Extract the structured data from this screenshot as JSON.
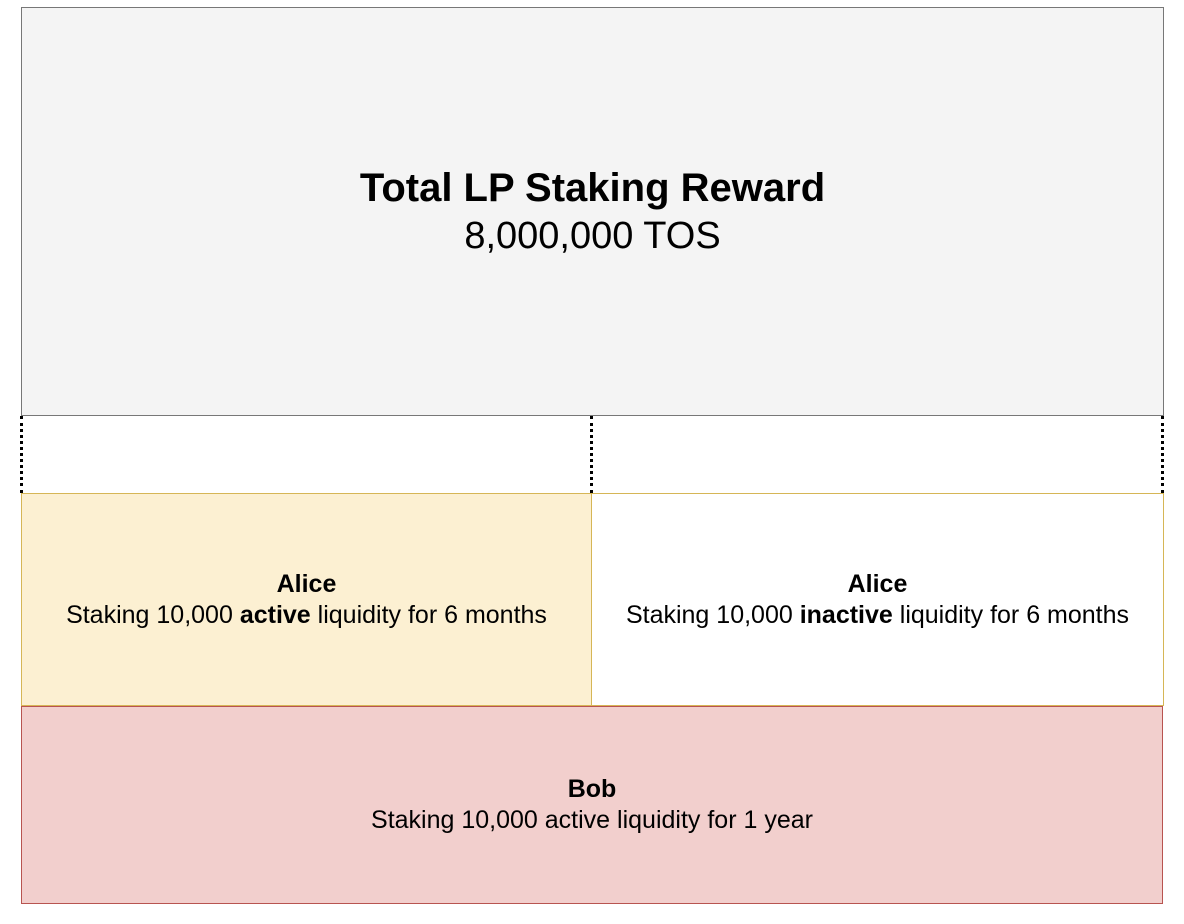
{
  "total": {
    "title": "Total LP Staking Reward",
    "amount": "8,000,000 TOS"
  },
  "alice_active": {
    "name": "Alice",
    "desc_prefix": "Staking 10,000 ",
    "desc_emphasis": "active",
    "desc_suffix": " liquidity for 6 months"
  },
  "alice_inactive": {
    "name": "Alice",
    "desc_prefix": "Staking 10,000 ",
    "desc_emphasis": "inactive",
    "desc_suffix": " liquidity for 6 months"
  },
  "bob": {
    "name": "Bob",
    "desc": "Staking 10,000 active liquidity for 1 year"
  },
  "colors": {
    "total_fill": "#f4f4f4",
    "total_stroke": "#777777",
    "alice_active_fill": "#fcf0d2",
    "alice_stroke": "#d6b656",
    "alice_inactive_fill": "#ffffff",
    "bob_fill": "#f2cfcd",
    "bob_stroke": "#b85450"
  }
}
